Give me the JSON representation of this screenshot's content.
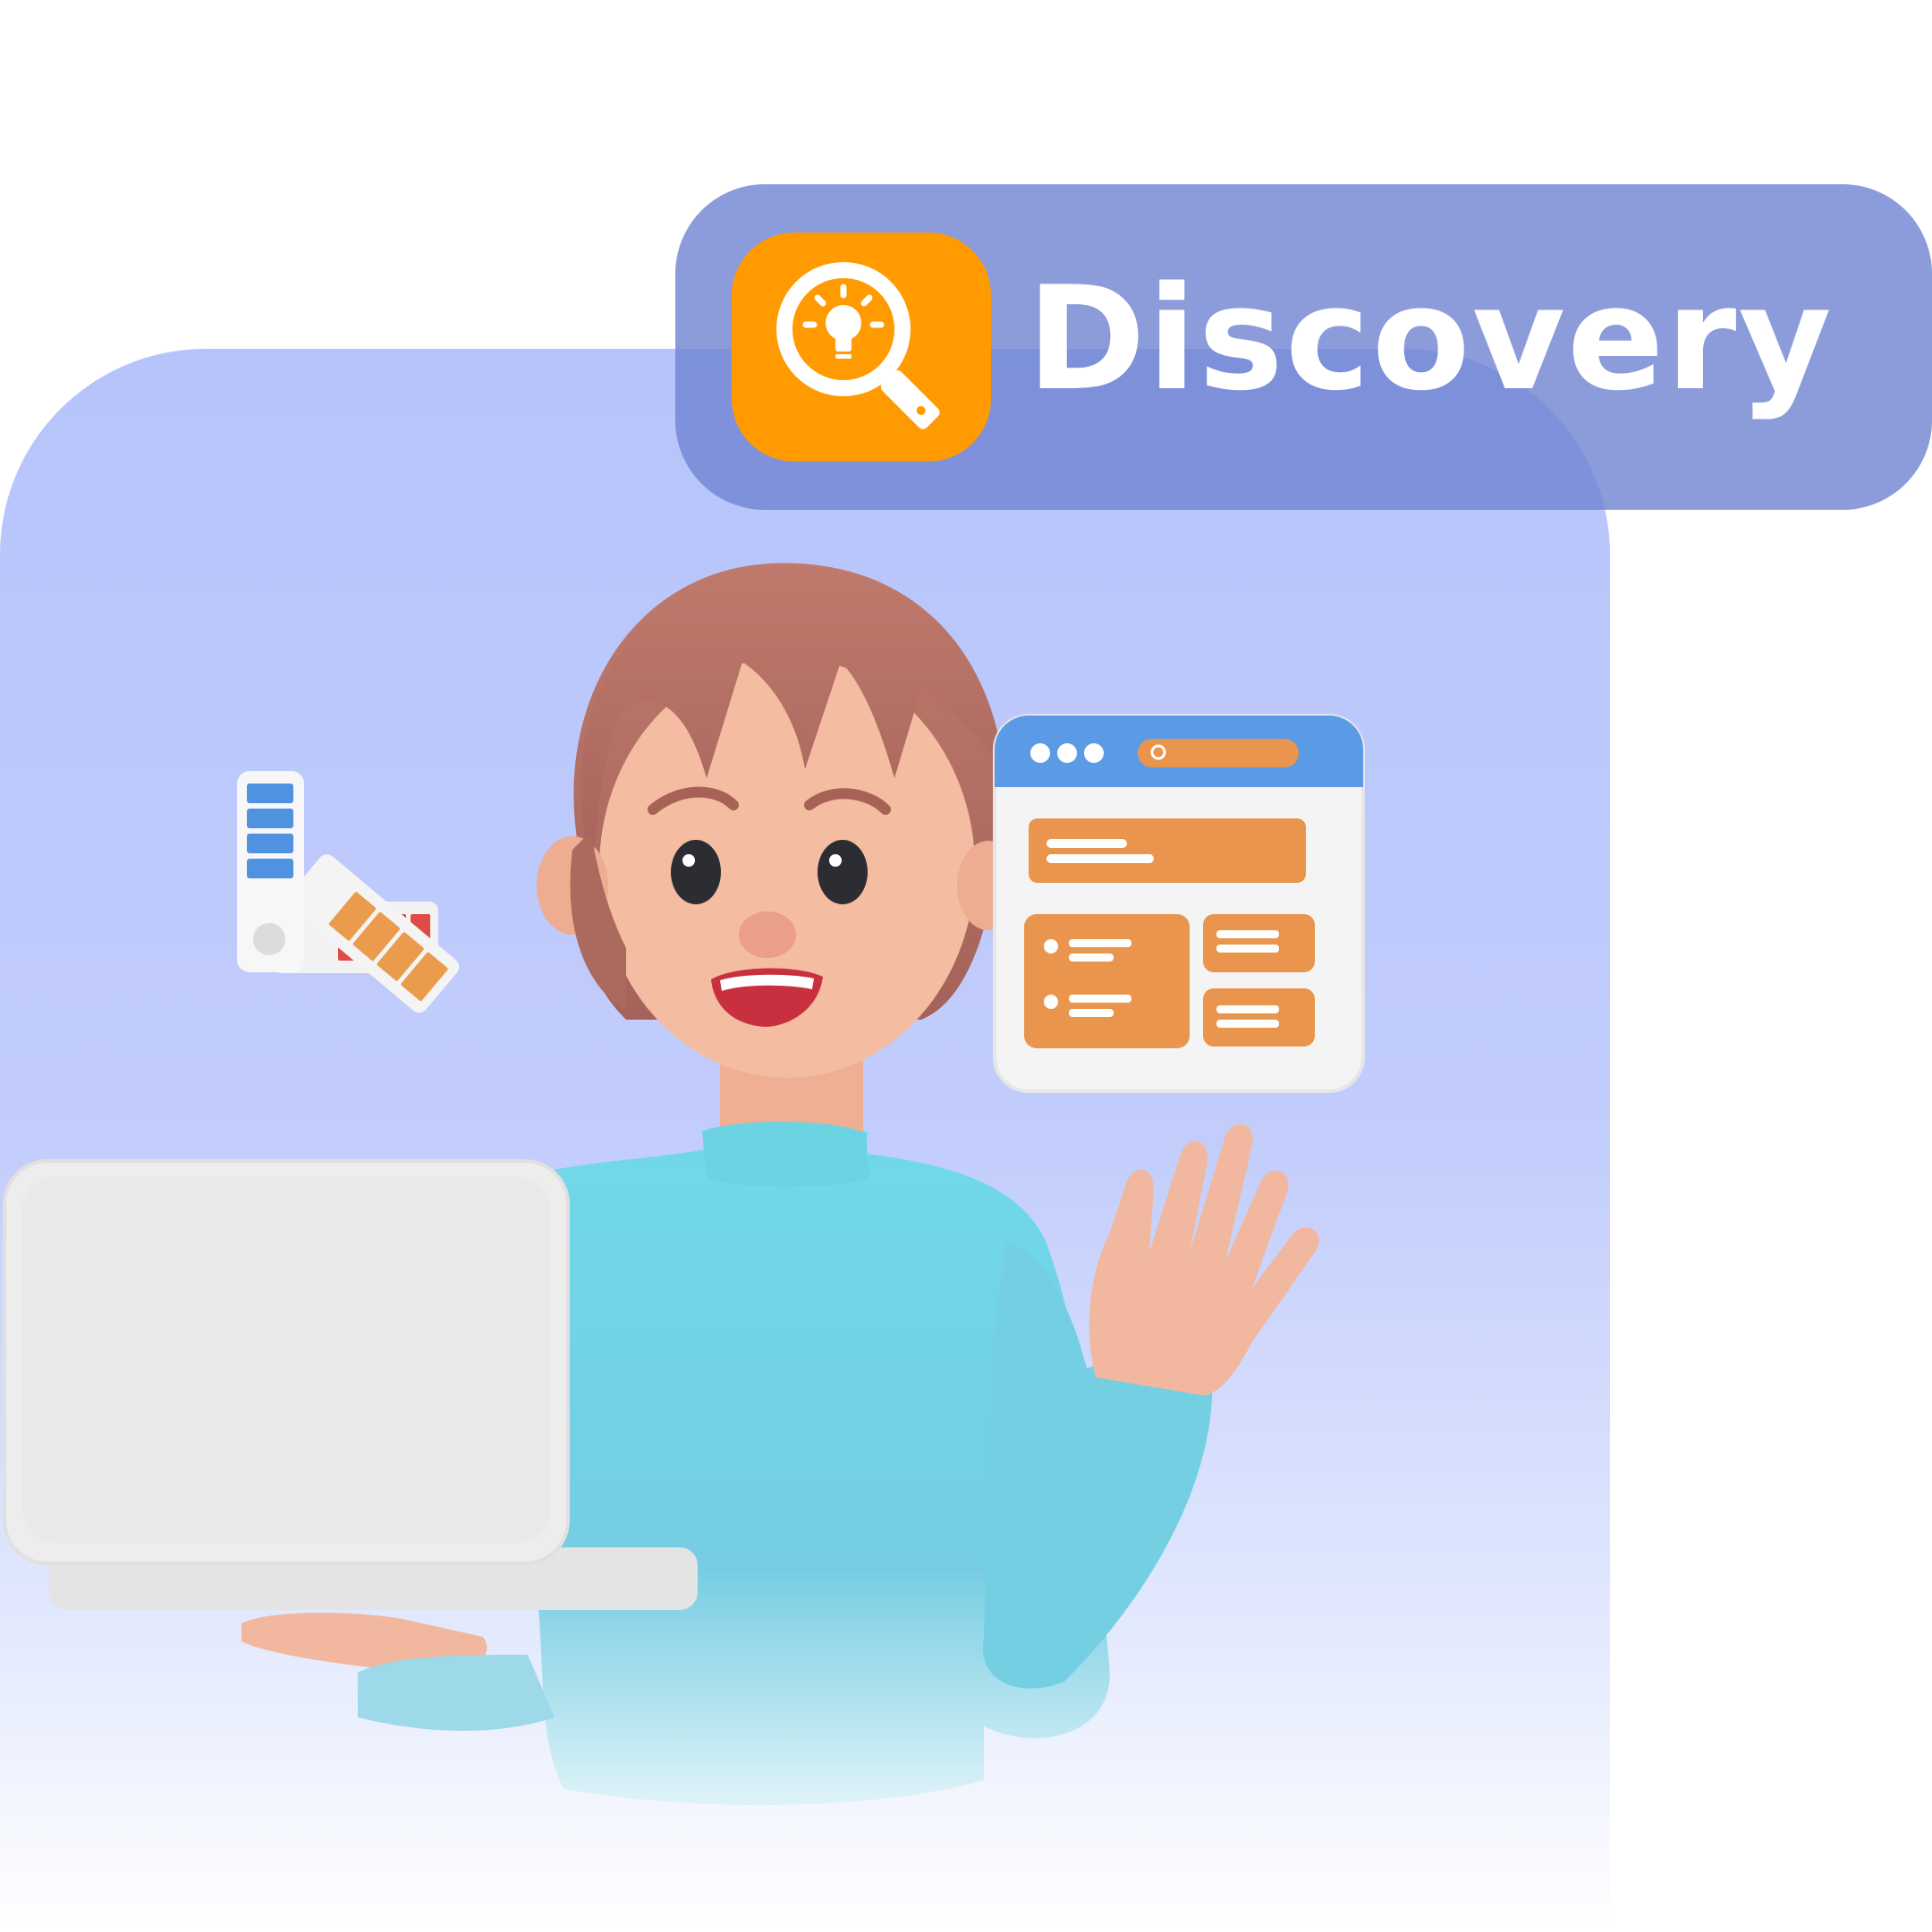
{
  "badge": {
    "label": "Discovery",
    "icon": "idea-search-icon",
    "tile_color": "#ff9a00",
    "pill_color": "#7284d4"
  },
  "illustration": {
    "character": "woman-waving-holding-laptop",
    "props": [
      "color-swatch-fan",
      "browser-window-mockup",
      "laptop"
    ]
  },
  "colors": {
    "backdrop": "#b6c4fb",
    "sweater": "#6fd6e6",
    "hair": "#b77467",
    "window_accent": "#e9954d",
    "window_bar": "#5b9be6"
  }
}
